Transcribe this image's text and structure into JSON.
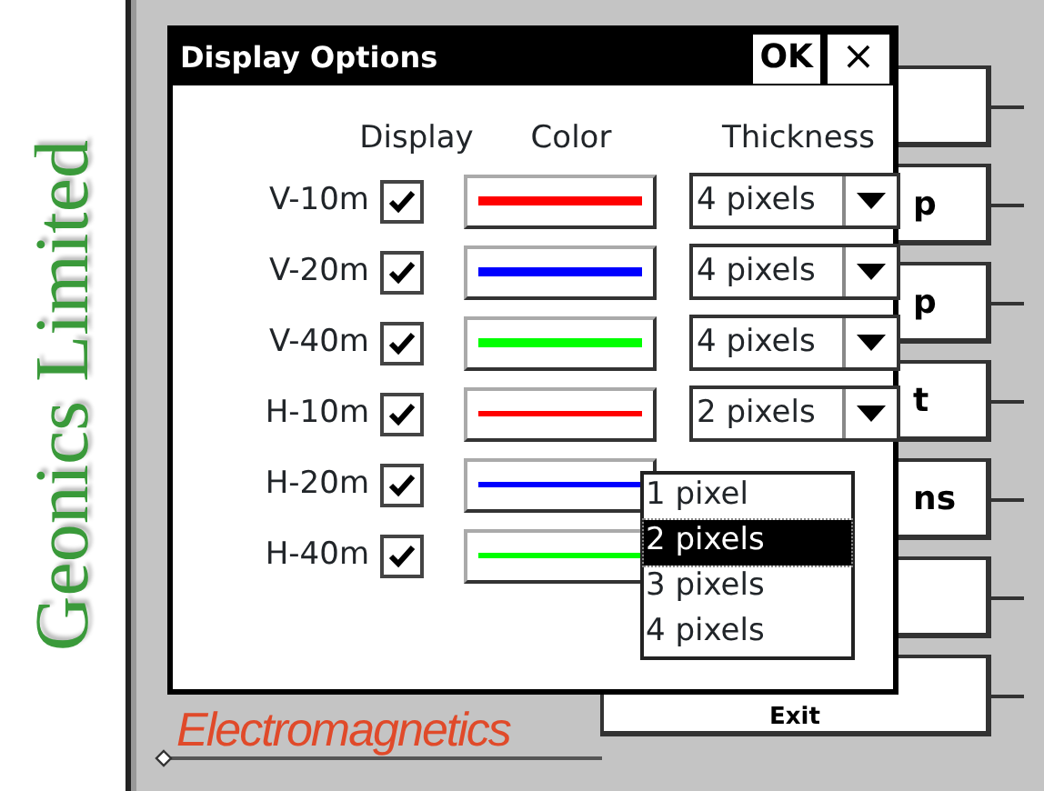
{
  "sidebar": {
    "brand": "Geonics Limited"
  },
  "background": {
    "buttons": [
      {
        "kind": "blank"
      },
      {
        "kind": "text",
        "label": "p"
      },
      {
        "kind": "text",
        "label": "p"
      },
      {
        "kind": "text",
        "label": "t"
      },
      {
        "kind": "text",
        "label": "ns"
      },
      {
        "kind": "blank"
      },
      {
        "kind": "low",
        "label": "Exit"
      }
    ],
    "footer": "Electromagnetics"
  },
  "dialog": {
    "title": "Display Options",
    "ok": "OK",
    "close": "×",
    "columns": [
      "Display",
      "Color",
      "Thickness"
    ],
    "rows": [
      {
        "name": "V-10m",
        "checked": true,
        "color": "#ff0000",
        "kind": "thick",
        "thickness": "4 pixels"
      },
      {
        "name": "V-20m",
        "checked": true,
        "color": "#0000ff",
        "kind": "thick",
        "thickness": "4 pixels"
      },
      {
        "name": "V-40m",
        "checked": true,
        "color": "#00ff00",
        "kind": "thick",
        "thickness": "4 pixels"
      },
      {
        "name": "H-10m",
        "checked": true,
        "color": "#ff0000",
        "kind": "thin",
        "thickness": "2 pixels"
      },
      {
        "name": "H-20m",
        "checked": true,
        "color": "#0000ff",
        "kind": "thin"
      },
      {
        "name": "H-40m",
        "checked": true,
        "color": "#00ff00",
        "kind": "thin"
      }
    ],
    "dropdown": [
      {
        "label": "1 pixel",
        "selected": false
      },
      {
        "label": "2 pixels",
        "selected": true
      },
      {
        "label": "3 pixels",
        "selected": false
      },
      {
        "label": "4 pixels",
        "selected": false
      }
    ]
  }
}
